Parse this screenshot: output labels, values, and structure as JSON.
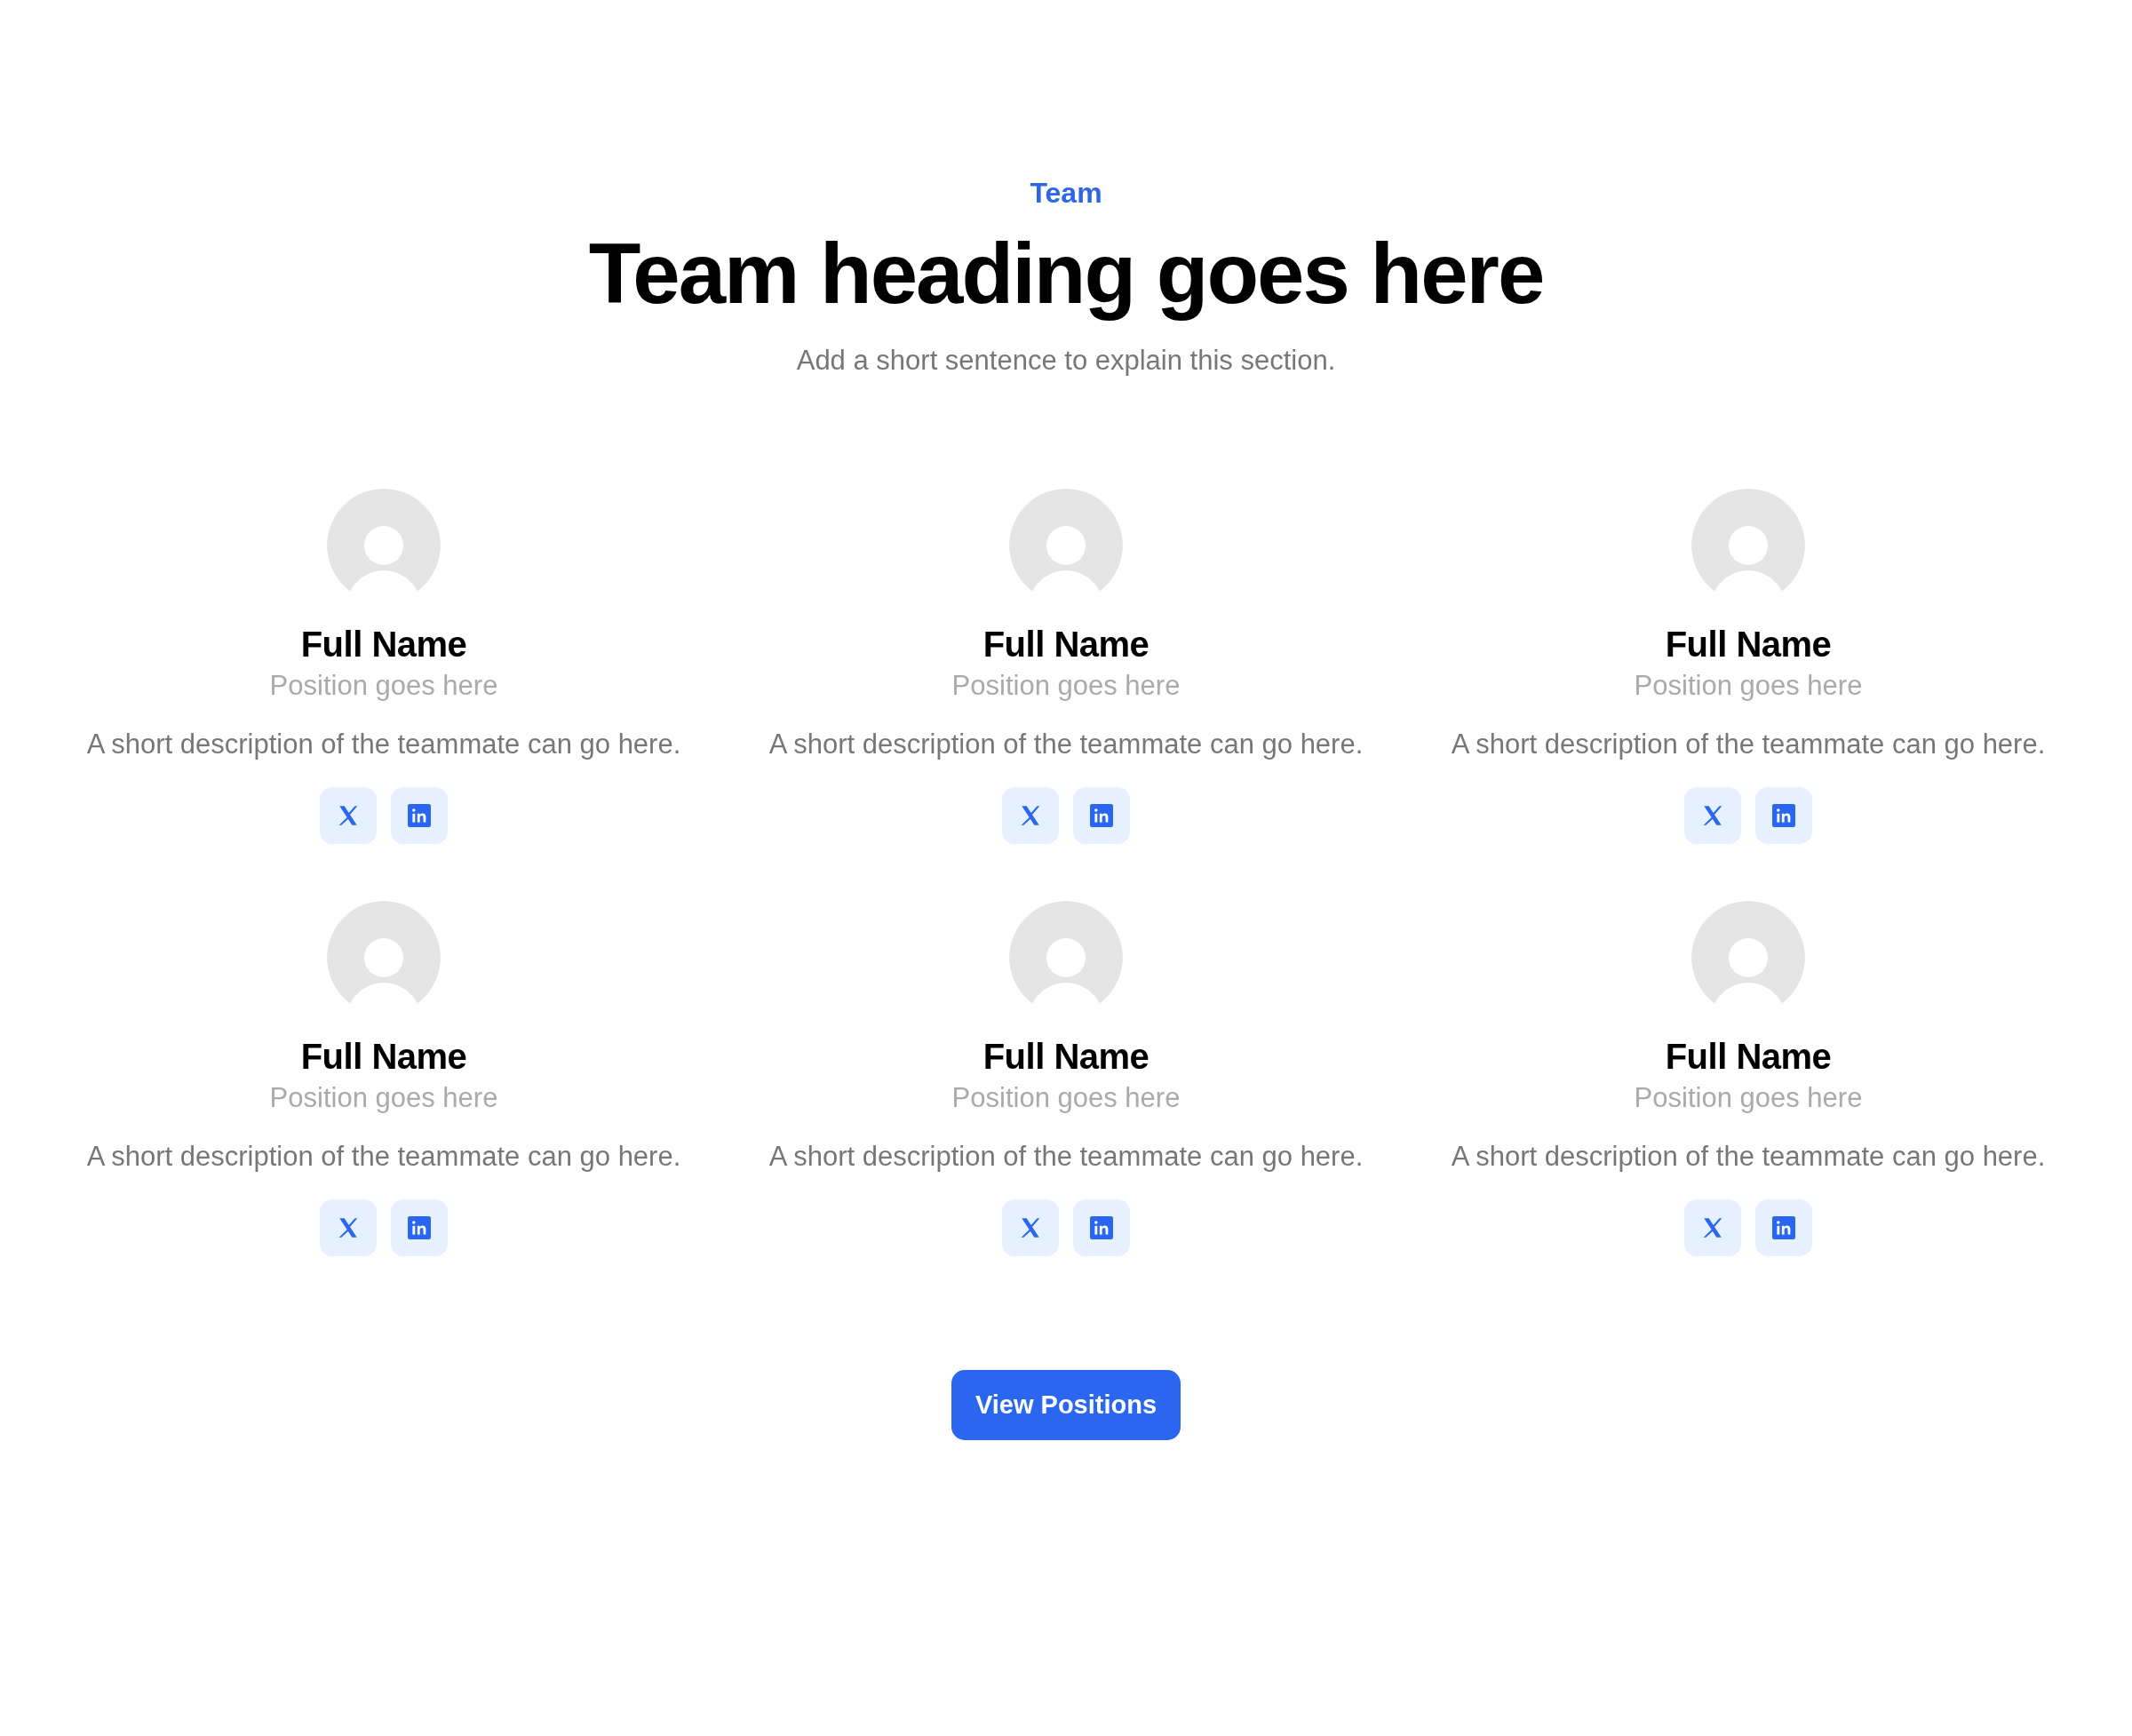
{
  "header": {
    "eyebrow": "Team",
    "heading": "Team heading goes here",
    "subtitle": "Add a short sentence to explain this section."
  },
  "members": [
    {
      "name": "Full Name",
      "position": "Position goes here",
      "description": "A short description of the teammate can go here.",
      "socials": [
        {
          "kind": "x"
        },
        {
          "kind": "linkedin"
        }
      ]
    },
    {
      "name": "Full Name",
      "position": "Position goes here",
      "description": "A short description of the teammate can go here.",
      "socials": [
        {
          "kind": "x"
        },
        {
          "kind": "linkedin"
        }
      ]
    },
    {
      "name": "Full Name",
      "position": "Position goes here",
      "description": "A short description of the teammate can go here.",
      "socials": [
        {
          "kind": "x"
        },
        {
          "kind": "linkedin"
        }
      ]
    },
    {
      "name": "Full Name",
      "position": "Position goes here",
      "description": "A short description of the teammate can go here.",
      "socials": [
        {
          "kind": "x"
        },
        {
          "kind": "linkedin"
        }
      ]
    },
    {
      "name": "Full Name",
      "position": "Position goes here",
      "description": "A short description of the teammate can go here.",
      "socials": [
        {
          "kind": "x"
        },
        {
          "kind": "linkedin"
        }
      ]
    },
    {
      "name": "Full Name",
      "position": "Position goes here",
      "description": "A short description of the teammate can go here.",
      "socials": [
        {
          "kind": "x"
        },
        {
          "kind": "linkedin"
        }
      ]
    }
  ],
  "button": "View Positions"
}
